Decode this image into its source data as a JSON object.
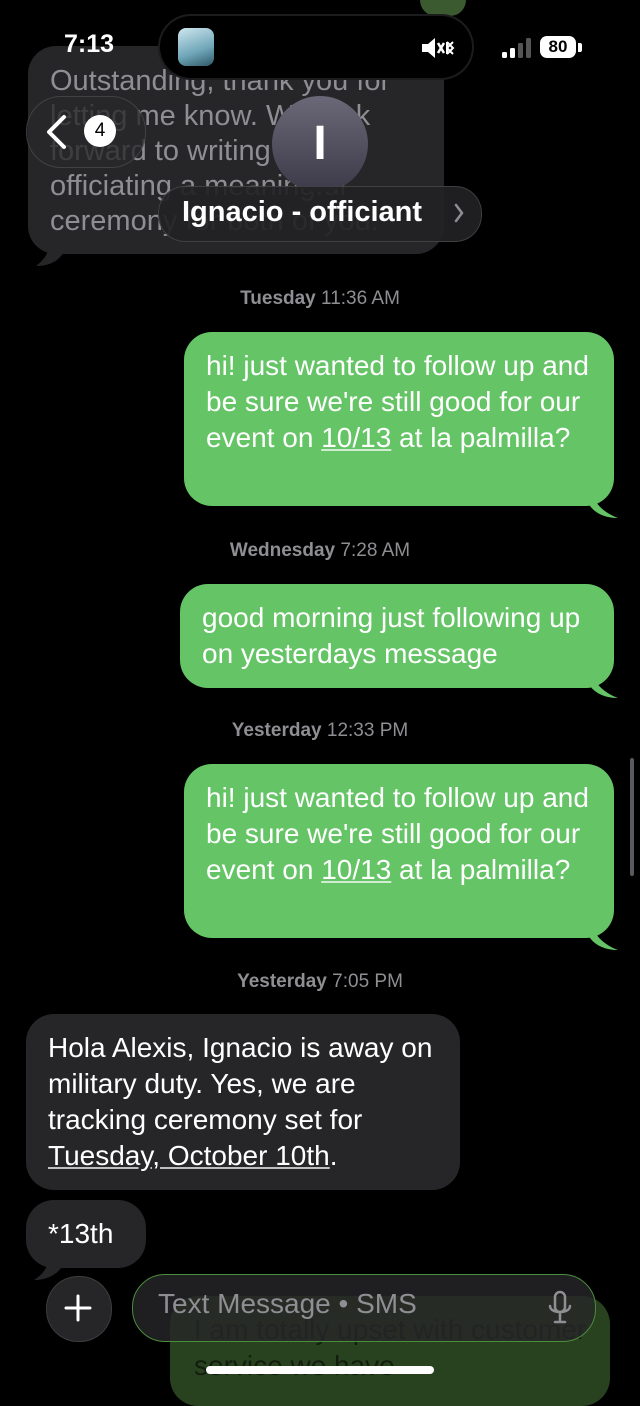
{
  "status_bar": {
    "time": "7:13",
    "battery": "80"
  },
  "header": {
    "back_count": "4",
    "avatar_initial": "I",
    "contact_name": "Ignacio - officiant"
  },
  "top_message": {
    "text": "Outstanding, thank you for letting me know. We look forward to writing and officiating a meaningful ceremony for both of you."
  },
  "messages": [
    {
      "timestamp_day": "Tuesday",
      "timestamp_time": "11:36 AM",
      "before": "hi! just wanted to follow up and be sure we're still good for our event on ",
      "link": "10/13",
      "after": " at la palmilla?"
    },
    {
      "timestamp_day": "Wednesday",
      "timestamp_time": "7:28 AM",
      "text": "good morning just following up on yesterdays message"
    },
    {
      "timestamp_day": "Yesterday",
      "timestamp_time": "12:33 PM",
      "before": "hi! just wanted to follow up and be sure we're still good for our event on ",
      "link": "10/13",
      "after": " at la palmilla?"
    },
    {
      "timestamp_day": "Yesterday",
      "timestamp_time": "7:05 PM",
      "before": "Hola Alexis, Ignacio is away on military duty. Yes, we are tracking ceremony set for ",
      "link": "Tuesday, October 10th",
      "after": "."
    },
    {
      "text": "*13th"
    }
  ],
  "composer": {
    "placeholder": "Text Message • SMS",
    "draft_under": "I am totally upset with customer service we have"
  },
  "colors": {
    "outgoing": "#65c466",
    "incoming": "#262628",
    "accent": "#65c466"
  },
  "icons": [
    "chevron-left-icon",
    "chevron-right-icon",
    "plus-icon",
    "mic-icon",
    "mute-icon",
    "bluetooth-icon",
    "signal-icon",
    "battery-icon"
  ]
}
